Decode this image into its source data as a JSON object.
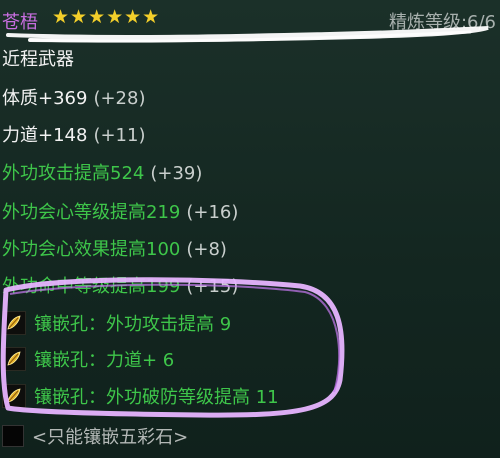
{
  "item": {
    "name": "苍梧",
    "stars": "★★★★★★",
    "refine_label": "精炼等级:",
    "refine_value": "6/6"
  },
  "type": "近程武器",
  "base_stats": [
    {
      "label": "体质+369",
      "bonus": "(+28)"
    },
    {
      "label": "力道+148",
      "bonus": "(+11)"
    }
  ],
  "green_stats": [
    {
      "label": "外功攻击提高524",
      "bonus": "(+39)"
    },
    {
      "label": "外功会心等级提高219",
      "bonus": "(+16)"
    },
    {
      "label": "外功会心效果提高100",
      "bonus": "(+8)"
    },
    {
      "label": "外功命中等级提高199",
      "bonus": "(+15)"
    }
  ],
  "sockets": [
    {
      "text": "镶嵌孔：外功攻击提高 9",
      "icon": "golden-feather-gem-icon"
    },
    {
      "text": "镶嵌孔：力道+ 6",
      "icon": "golden-feather-gem-icon"
    },
    {
      "text": "镶嵌孔：外功破防等级提高 11",
      "icon": "golden-feather-gem-icon"
    }
  ],
  "colorful_slot": {
    "text": "<只能镶嵌五彩石>"
  },
  "colors": {
    "name": "#c86ee0",
    "stars": "#f3cf2a",
    "green_stat": "#3ec64a",
    "annotation": "#d9b6f2"
  }
}
